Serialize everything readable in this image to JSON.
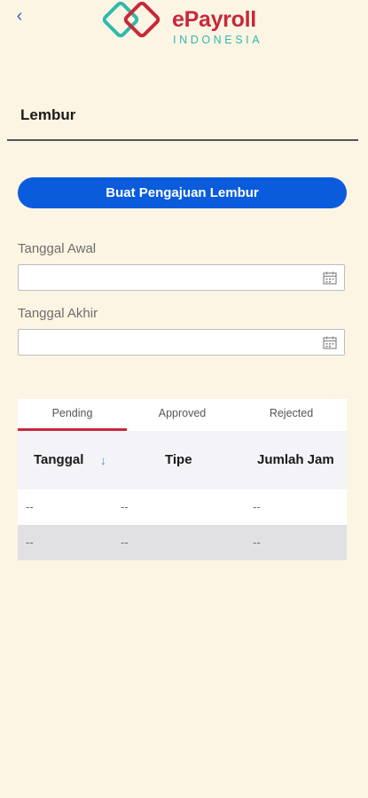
{
  "header": {
    "back_glyph": "‹",
    "logo": {
      "main": "ePayroll",
      "sub": "INDONESIA"
    }
  },
  "page": {
    "title": "Lembur"
  },
  "actions": {
    "create_label": "Buat Pengajuan Lembur"
  },
  "form": {
    "start_date": {
      "label": "Tanggal Awal",
      "value": ""
    },
    "end_date": {
      "label": "Tanggal Akhir",
      "value": ""
    }
  },
  "tabs": [
    {
      "label": "Pending",
      "active": true
    },
    {
      "label": "Approved",
      "active": false
    },
    {
      "label": "Rejected",
      "active": false
    }
  ],
  "table": {
    "columns": [
      "Tanggal",
      "Tipe",
      "Jumlah Jam"
    ],
    "sort_glyph": "↓",
    "rows": [
      {
        "c1": "--",
        "c2": "--",
        "c3": "--"
      },
      {
        "c1": "--",
        "c2": "--",
        "c3": "--"
      }
    ]
  },
  "colors": {
    "background": "#fdf5e3",
    "primary": "#0a5cdc",
    "brand_red": "#c8283a",
    "brand_teal": "#2fb9ad"
  },
  "icons": [
    "chevron-left-icon",
    "calendar-icon",
    "sort-down-icon"
  ]
}
